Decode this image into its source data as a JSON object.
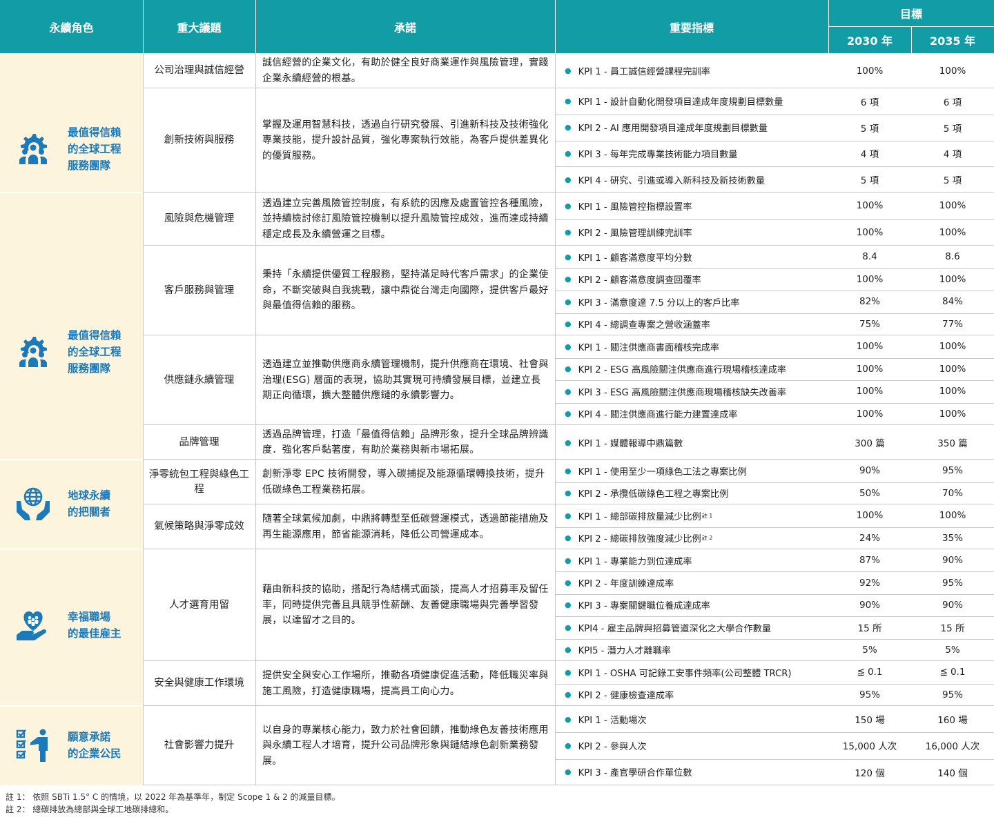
{
  "header": {
    "role": "永續角色",
    "topic": "重大議題",
    "commitment": "承諾",
    "indicators": "重要指標",
    "target": "目標",
    "y2030": "2030 年",
    "y2035": "2035 年"
  },
  "roles": [
    {
      "label": [
        "最值得信賴",
        "的全球工程",
        "服務團隊"
      ],
      "icon": "team-gear-icon"
    },
    {
      "label": [
        "最值得信賴",
        "的全球工程",
        "服務團隊"
      ],
      "icon": "team-gear-icon"
    },
    {
      "label": [
        "地球永續",
        "的把關者"
      ],
      "icon": "globe-hands-icon"
    },
    {
      "label": [
        "幸福職場",
        "的最佳雇主"
      ],
      "icon": "heart-hand-people-icon"
    },
    {
      "label": [
        "願意承諾",
        "的企業公民"
      ],
      "icon": "checklist-person-icon"
    }
  ],
  "topics": [
    {
      "name": "公司治理與誠信經營",
      "commitment": "誠信經營的企業文化，有助於健全良好商業運作與風險管理，實踐企業永續經營的根基。",
      "kpis": [
        {
          "text": "KPI 1 - 員工誠信經營課程完訓率",
          "v2030": "100%",
          "v2035": "100%"
        }
      ]
    },
    {
      "name": "創新技術與服務",
      "commitment": "掌握及運用智慧科技，透過自行研究發展、引進新科技及技術強化專業技能，提升設計品質，強化專案執行效能，為客戶提供差異化的優質服務。",
      "kpis": [
        {
          "text": "KPI 1 - 設計自動化開發項目達成年度規劃目標數量",
          "v2030": "6 項",
          "v2035": "6 項"
        },
        {
          "text": "KPI 2 - AI 應用開發項目達成年度規劃目標數量",
          "v2030": "5 項",
          "v2035": "5 項"
        },
        {
          "text": "KPI 3 - 每年完成專業技術能力項目數量",
          "v2030": "4 項",
          "v2035": "4 項"
        },
        {
          "text": "KPI 4 - 研究、引進或導入新科技及新技術數量",
          "v2030": "5 項",
          "v2035": "5 項"
        }
      ]
    },
    {
      "name": "風險與危機管理",
      "commitment": "透過建立完善風險管控制度，有系統的因應及處置管控各種風險，並持續檢討修訂風險管控機制以提升風險管控成效，進而達成持續穩定成長及永續營運之目標。",
      "kpis": [
        {
          "text": "KPI 1 - 風險管控指標設置率",
          "v2030": "100%",
          "v2035": "100%"
        },
        {
          "text": "KPI 2 - 風險管理訓練完訓率",
          "v2030": "100%",
          "v2035": "100%"
        }
      ]
    },
    {
      "name": "客戶服務與管理",
      "commitment": "秉持「永續提供優質工程服務，堅持滿足時代客戶需求」的企業使命，不斷突破與自我挑戰，讓中鼎從台灣走向國際，提供客戶最好與最值得信賴的服務。",
      "kpis": [
        {
          "text": "KPI 1 - 顧客滿意度平均分數",
          "v2030": "8.4",
          "v2035": "8.6"
        },
        {
          "text": "KPI 2 - 顧客滿意度調查回覆率",
          "v2030": "100%",
          "v2035": "100%"
        },
        {
          "text": "KPI 3 - 滿意度達 7.5 分以上的客戶比率",
          "v2030": "82%",
          "v2035": "84%"
        },
        {
          "text": "KPI 4 - 總調查專案之營收涵蓋率",
          "v2030": "75%",
          "v2035": "77%"
        }
      ]
    },
    {
      "name": "供應鏈永續管理",
      "commitment": "透過建立並推動供應商永續管理機制，提升供應商在環境、社會與治理(ESG) 層面的表現，協助其實現可持續發展目標，並建立長期正向循環，擴大整體供應鏈的永續影響力。",
      "kpis": [
        {
          "text": "KPI 1 - 關注供應商書面稽核完成率",
          "v2030": "100%",
          "v2035": "100%"
        },
        {
          "text": "KPI 2 - ESG 高風險關注供應商進行現場稽核達成率",
          "v2030": "100%",
          "v2035": "100%"
        },
        {
          "text": "KPI 3 - ESG 高風險關注供應商現場稽核缺失改善率",
          "v2030": "100%",
          "v2035": "100%"
        },
        {
          "text": "KPI 4 - 關注供應商進行能力建置達成率",
          "v2030": "100%",
          "v2035": "100%"
        }
      ]
    },
    {
      "name": "品牌管理",
      "commitment": "透過品牌管理，打造「最值得信賴」品牌形象，提升全球品牌辨識度．強化客戶黏著度，有助於業務與新市場拓展。",
      "kpis": [
        {
          "text": "KPI 1 - 媒體報導中鼎篇數",
          "v2030": "300 篇",
          "v2035": "350 篇"
        }
      ]
    },
    {
      "name": "淨零統包工程與綠色工程",
      "commitment": "創新淨零 EPC 技術開發，導入碳捕捉及能源循環轉換技術，提升低碳綠色工程業務拓展。",
      "kpis": [
        {
          "text": "KPI 1 - 使用至少一項綠色工法之專案比例",
          "v2030": "90%",
          "v2035": "95%"
        },
        {
          "text": "KPI 2 - 承攬低碳綠色工程之專案比例",
          "v2030": "50%",
          "v2035": "70%"
        }
      ]
    },
    {
      "name": "氣候策略與淨零成效",
      "commitment": "隨著全球氣候加劇，中鼎將轉型至低碳營運模式，透過節能措施及再生能源應用，節省能源消耗，降低公司營運成本。",
      "kpis": [
        {
          "text": "KPI 1 - 總部碳排放量減少比例",
          "note": "註 1",
          "v2030": "100%",
          "v2035": "100%"
        },
        {
          "text": "KPI 2 - 總碳排放強度減少比例",
          "note": "註 2",
          "v2030": "24%",
          "v2035": "35%"
        }
      ]
    },
    {
      "name": "人才選育用留",
      "commitment": "藉由新科技的協助，搭配行為結構式面談，提高人才招募率及留任率，同時提供完善且具競爭性薪酬、友善健康職場與完善學習發展，以達留才之目的。",
      "kpis": [
        {
          "text": "KPI 1 - 專業能力到位達成率",
          "v2030": "87%",
          "v2035": "90%"
        },
        {
          "text": "KPI 2 - 年度訓練達成率",
          "v2030": "92%",
          "v2035": "95%"
        },
        {
          "text": "KPI 3 - 專案關鍵職位養成達成率",
          "v2030": "90%",
          "v2035": "90%"
        },
        {
          "text": "KPI4 - 雇主品牌與招募管道深化之大學合作數量",
          "v2030": "15 所",
          "v2035": "15 所"
        },
        {
          "text": "KPI5 - 潛力人才離職率",
          "v2030": "5%",
          "v2035": "5%"
        }
      ]
    },
    {
      "name": "安全與健康工作環境",
      "commitment": "提供安全與安心工作場所，推動各項健康促進活動，降低職災率與施工風險，打造健康職場，提高員工向心力。",
      "kpis": [
        {
          "text": "KPI 1 - OSHA 可記錄工安事件頻率(公司整體 TRCR)",
          "v2030": "≦ 0.1",
          "v2035": "≦ 0.1"
        },
        {
          "text": "KPI 2 - 健康檢查達成率",
          "v2030": "95%",
          "v2035": "95%"
        }
      ]
    },
    {
      "name": "社會影響力提升",
      "commitment": "以自身的專業核心能力，致力於社會回饋，推動綠色友善技術應用與永續工程人才培育，提升公司品牌形象與鏈結綠色創新業務發展。",
      "kpis": [
        {
          "text": "KPI 1 - 活動場次",
          "v2030": "150 場",
          "v2035": "160 場"
        },
        {
          "text": "KPI 2 - 參與人次",
          "v2030": "15,000 人次",
          "v2035": "16,000 人次"
        },
        {
          "text": "KPI 3 - 產官學研合作單位數",
          "v2030": "120 個",
          "v2035": "140 個"
        }
      ]
    }
  ],
  "notes": [
    "註 1： 依照 SBTi 1.5° C 的情境，以 2022 年為基準年，制定 Scope 1 & 2 的減量目標。",
    "註 2： 總碳排放為總部與全球工地碳排總和。"
  ]
}
